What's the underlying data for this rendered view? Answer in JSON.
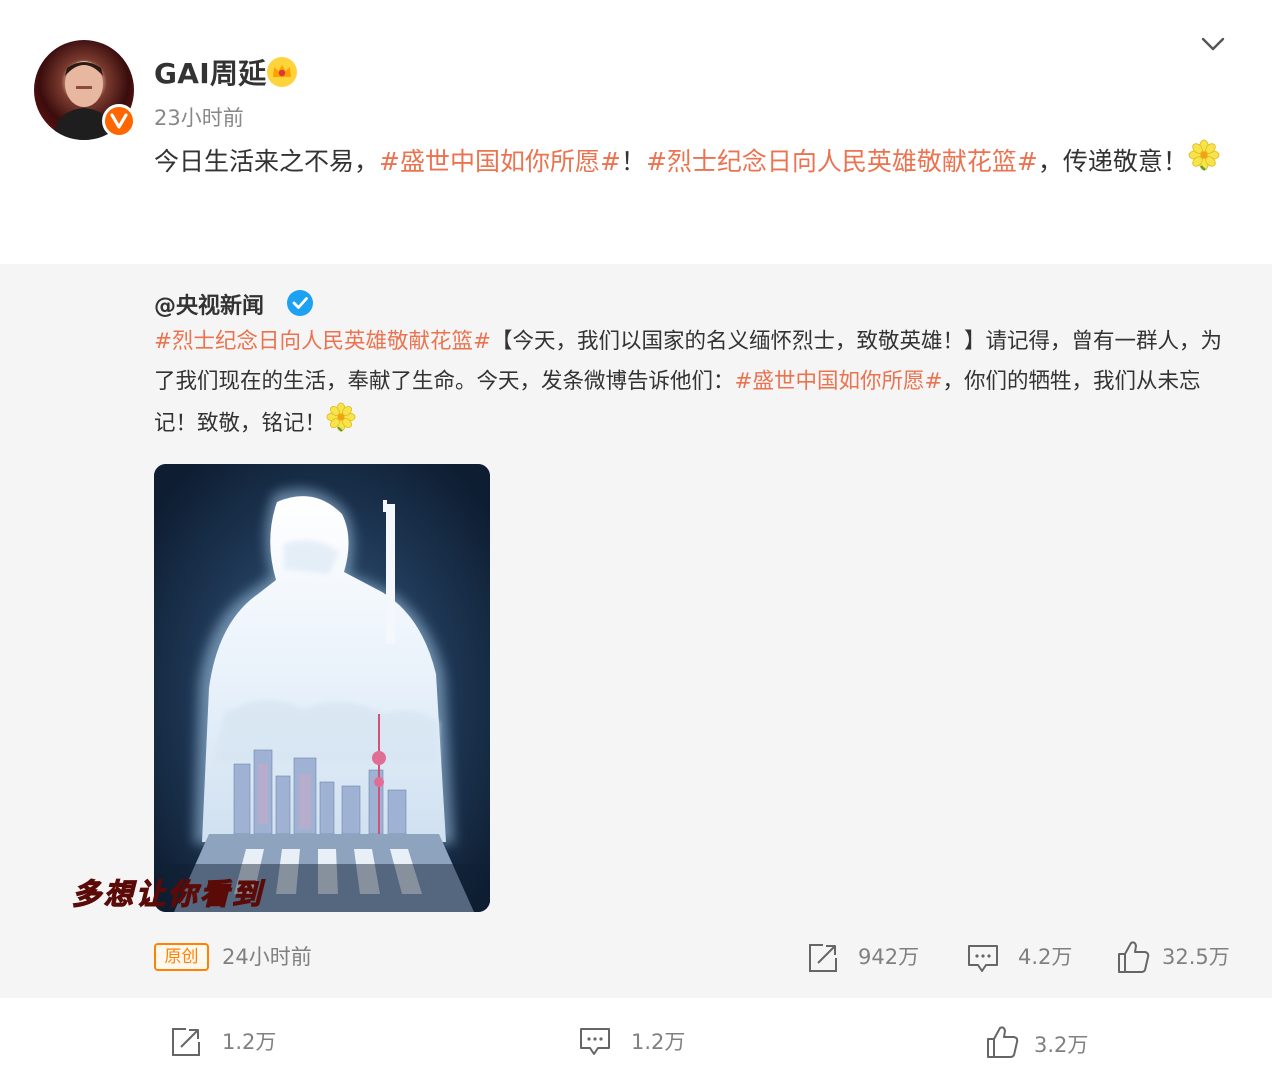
{
  "post": {
    "author": "GAI周延",
    "time": "23小时前",
    "text_parts": [
      "今日生活来之不易，",
      "#盛世中国如你所愿#",
      "！",
      "#烈士纪念日向人民英雄敬献花篮#",
      "，传递敬意！"
    ],
    "emoji": "flower-emoji"
  },
  "repost": {
    "author": "@央视新闻",
    "text_parts": [
      "#烈士纪念日向人民英雄敬献花篮#",
      "【今天，我们以国家的名义缅怀烈士，致敬英雄！】请记得，曾有一群人，为了我们现在的生活，奉献了生命。今天，发条微博告诉他们：",
      "#盛世中国如你所愿#",
      "，你们的牺牲，我们从未忘记！致敬，铭记！"
    ],
    "image_caption": "多想让你看到",
    "original_badge": "原创",
    "time": "24小时前",
    "shares": "942万",
    "comments": "4.2万",
    "likes": "32.5万"
  },
  "footer": {
    "shares": "1.2万",
    "comments": "1.2万",
    "likes": "3.2万"
  },
  "colors": {
    "topic": "#eb7350",
    "badge_orange": "#ff8200",
    "verified_blue": "#1da1f2"
  }
}
